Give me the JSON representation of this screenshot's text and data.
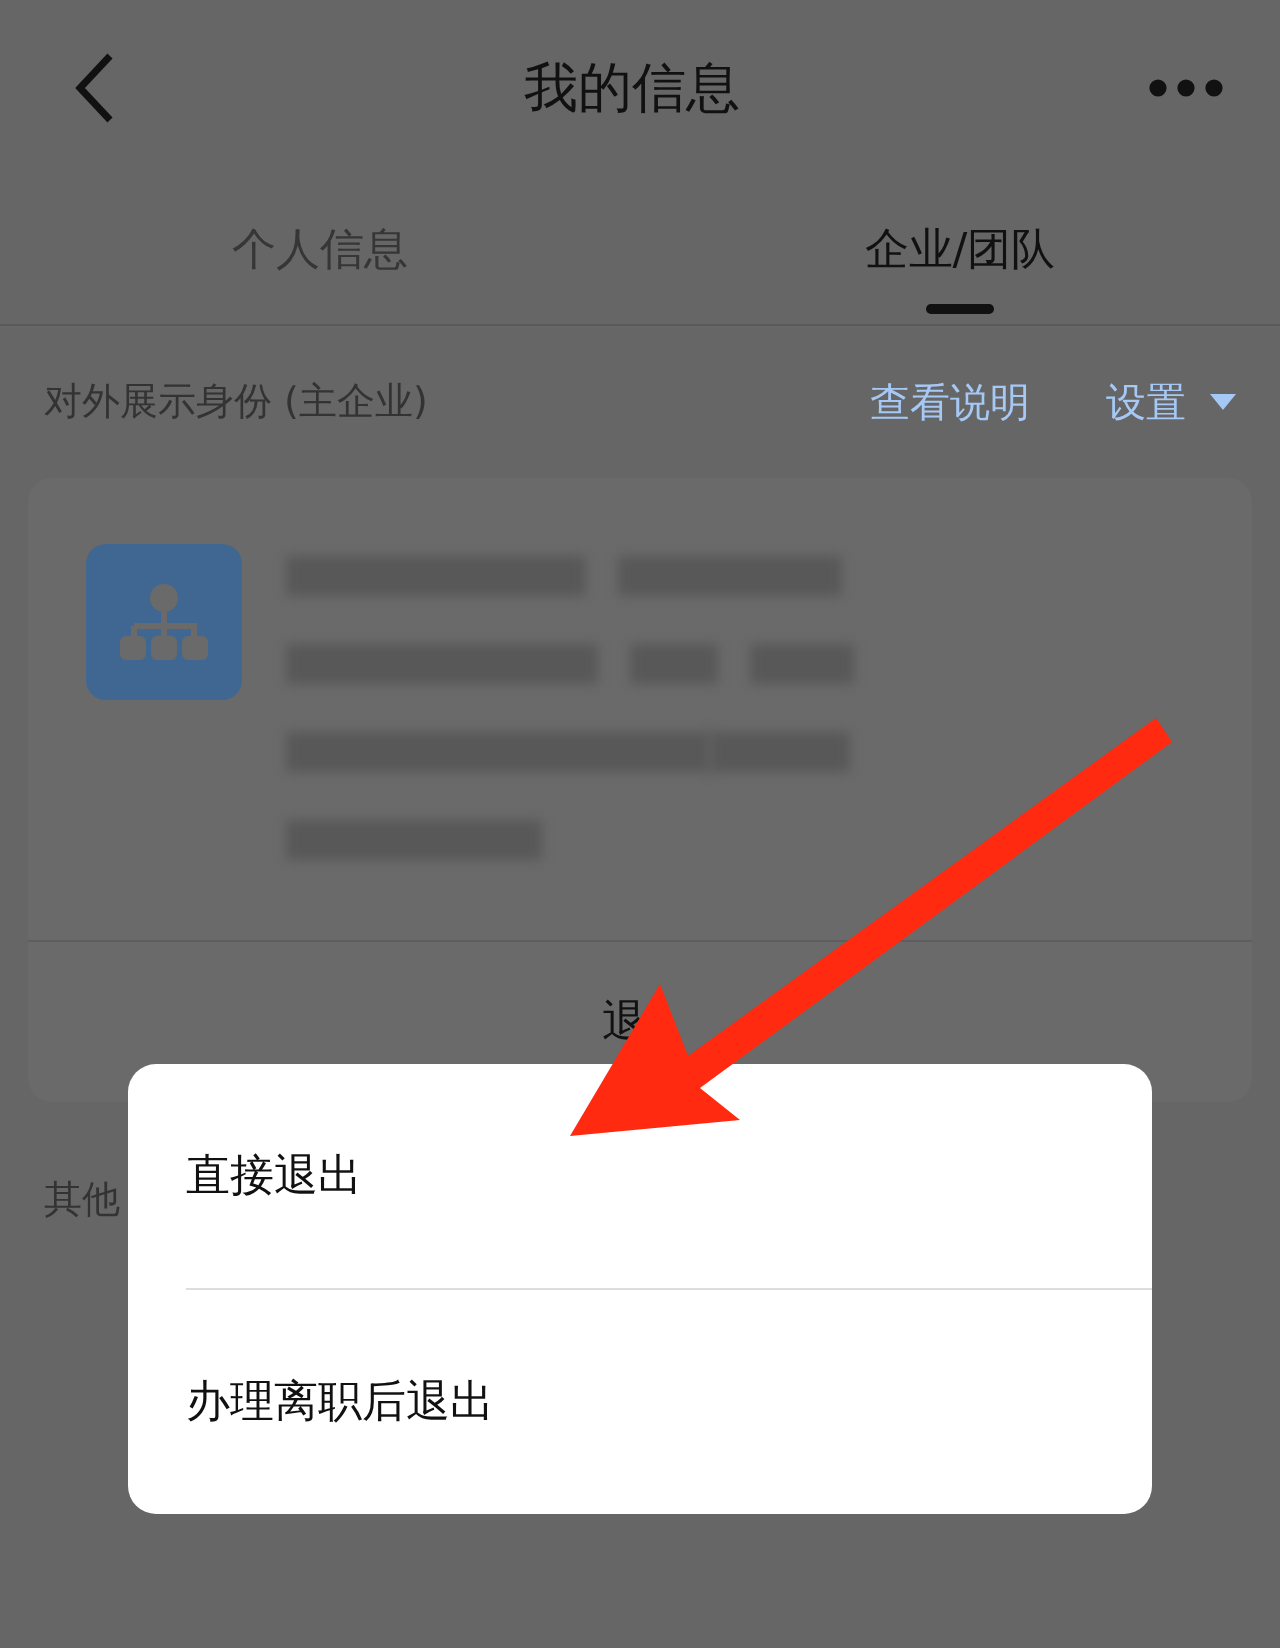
{
  "header": {
    "title": "我的信息"
  },
  "tabs": [
    {
      "label": "个人信息",
      "selected": false
    },
    {
      "label": "企业/团队",
      "selected": true
    }
  ],
  "identity": {
    "label": "对外展示身份 (主企业)",
    "help_link": "查看说明",
    "settings": "设置"
  },
  "card": {
    "action": "退"
  },
  "other_section": {
    "label": "其他"
  },
  "dialog": {
    "options": [
      "直接退出",
      "办理离职后退出"
    ]
  }
}
